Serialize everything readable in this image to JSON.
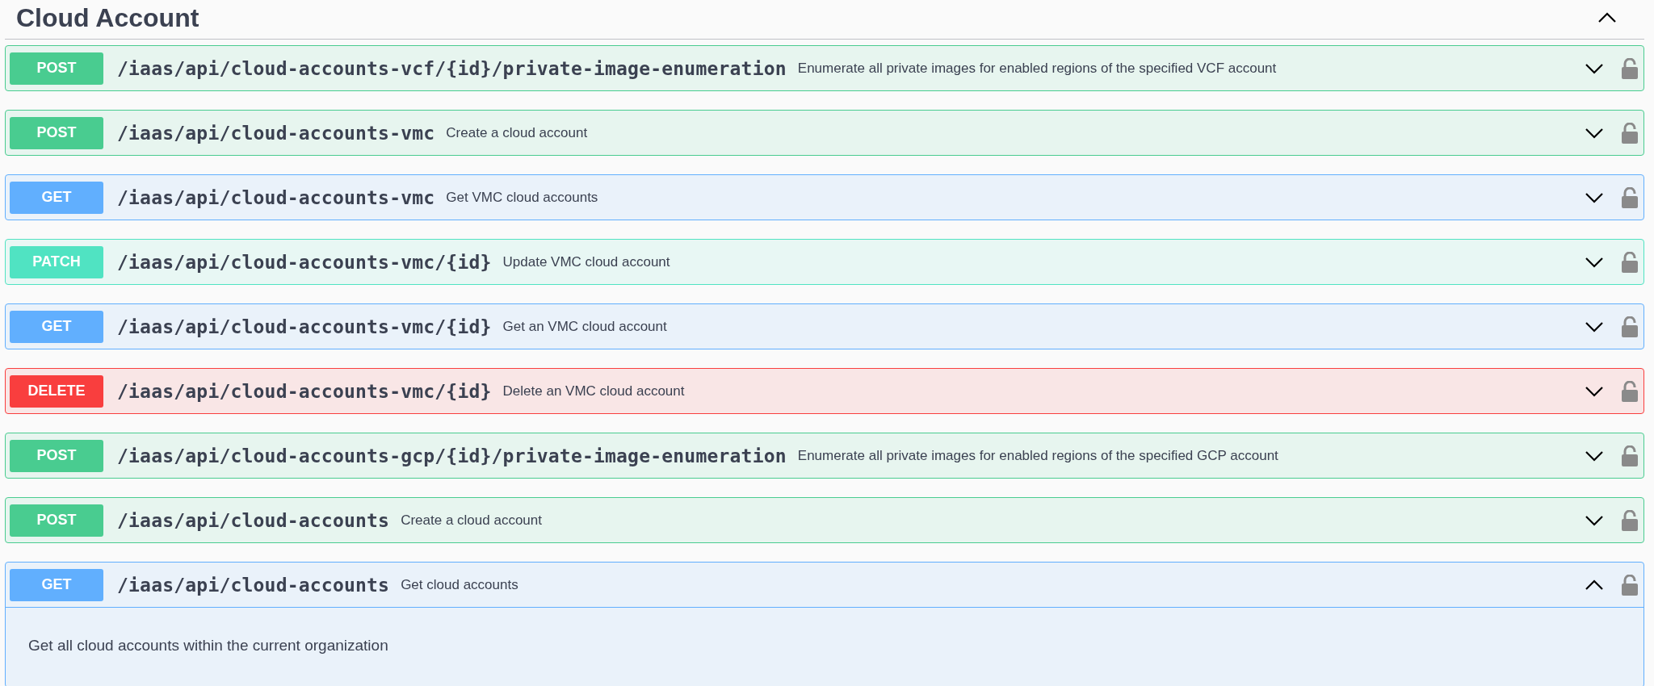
{
  "section": {
    "title": "Cloud Account",
    "expanded": true
  },
  "operations": [
    {
      "kind": "post",
      "method": "POST",
      "path": "/iaas/api/cloud-accounts-vcf/{id}/private-image-enumeration",
      "summary": "Enumerate all private images for enabled regions of the specified VCF account",
      "expanded": false
    },
    {
      "kind": "post",
      "method": "POST",
      "path": "/iaas/api/cloud-accounts-vmc",
      "summary": "Create a cloud account",
      "expanded": false
    },
    {
      "kind": "get",
      "method": "GET",
      "path": "/iaas/api/cloud-accounts-vmc",
      "summary": "Get VMC cloud accounts",
      "expanded": false
    },
    {
      "kind": "patch",
      "method": "PATCH",
      "path": "/iaas/api/cloud-accounts-vmc/{id}",
      "summary": "Update VMC cloud account",
      "expanded": false
    },
    {
      "kind": "get",
      "method": "GET",
      "path": "/iaas/api/cloud-accounts-vmc/{id}",
      "summary": "Get an VMC cloud account",
      "expanded": false
    },
    {
      "kind": "delete",
      "method": "DELETE",
      "path": "/iaas/api/cloud-accounts-vmc/{id}",
      "summary": "Delete an VMC cloud account",
      "expanded": false
    },
    {
      "kind": "post",
      "method": "POST",
      "path": "/iaas/api/cloud-accounts-gcp/{id}/private-image-enumeration",
      "summary": "Enumerate all private images for enabled regions of the specified GCP account",
      "expanded": false
    },
    {
      "kind": "post",
      "method": "POST",
      "path": "/iaas/api/cloud-accounts",
      "summary": "Create a cloud account",
      "expanded": false
    },
    {
      "kind": "get",
      "method": "GET",
      "path": "/iaas/api/cloud-accounts",
      "summary": "Get cloud accounts",
      "expanded": true,
      "description": "Get all cloud accounts within the current organization"
    }
  ]
}
